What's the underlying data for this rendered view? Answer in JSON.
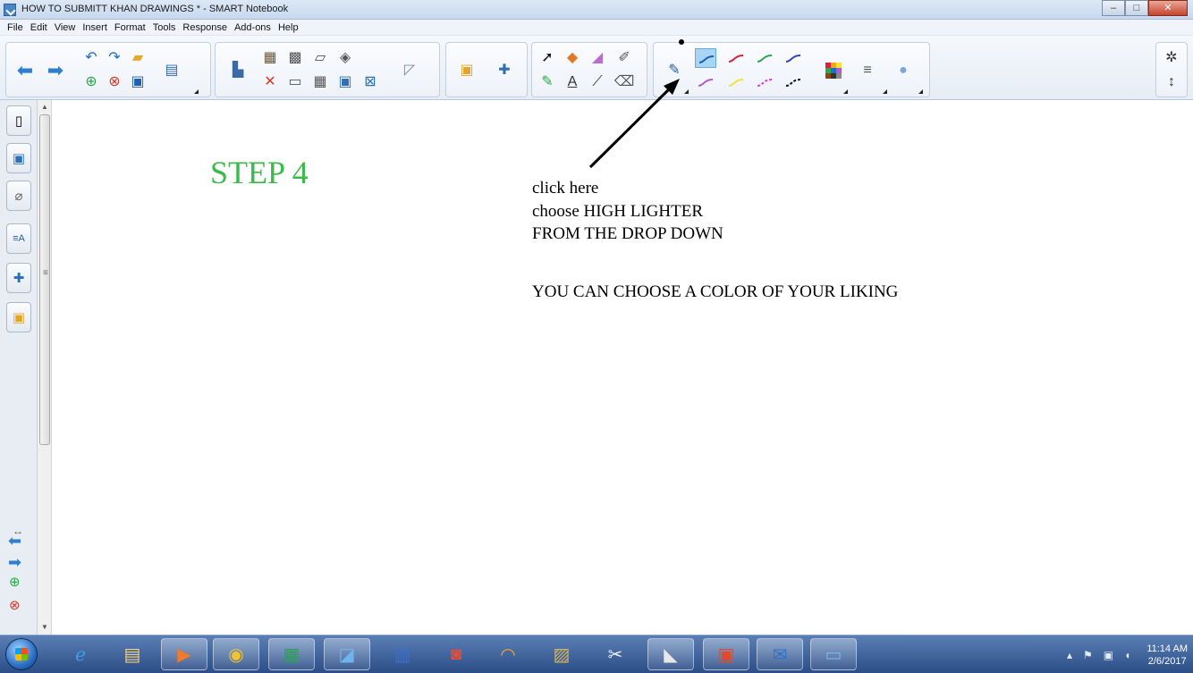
{
  "window": {
    "title": "HOW TO SUBMITT KHAN DRAWINGS * - SMART Notebook",
    "minimize_glyph": "–",
    "maximize_glyph": "□",
    "close_glyph": "✕"
  },
  "menu": [
    "File",
    "Edit",
    "View",
    "Insert",
    "Format",
    "Tools",
    "Response",
    "Add-ons",
    "Help"
  ],
  "toolbar": {
    "text_tool_glyph": "A",
    "pen_colors": {
      "top": [
        "#1a5fae",
        "#e0203a",
        "#2aa84a",
        "#2e48c0"
      ],
      "bottom": [
        "#b05cc8",
        "#f2e33b",
        "#e63ad6",
        "#111111"
      ]
    },
    "selected_pen_index": 0
  },
  "sidebar": {
    "tabs": [
      "page-sorter-icon",
      "gallery-icon",
      "attachments-icon",
      "properties-icon",
      "add-ons-icon",
      "response-icon"
    ],
    "resize_glyph": "↔",
    "bottom_controls": [
      "previous-page-icon",
      "next-page-icon",
      "add-page-icon",
      "delete-page-icon"
    ]
  },
  "canvas": {
    "step_title": "STEP 4",
    "step_color": "#3bba4a",
    "instructions": [
      "click here",
      "choose HIGH LIGHTER",
      "FROM THE DROP DOWN",
      "YOU CAN CHOOSE A COLOR OF YOUR LIKING"
    ]
  },
  "taskbar": {
    "apps": [
      "internet-explorer-icon",
      "file-explorer-icon",
      "media-player-icon",
      "chrome-icon",
      "excel-icon",
      "smart-notebook-icon",
      "word-icon",
      "snagit-icon",
      "audacity-icon",
      "app-icon",
      "snipping-tool-icon",
      "document-camera-icon",
      "powerpoint-icon",
      "outlook-icon",
      "photos-icon"
    ],
    "clock_time": "11:14 AM",
    "clock_date": "2/6/2017"
  }
}
